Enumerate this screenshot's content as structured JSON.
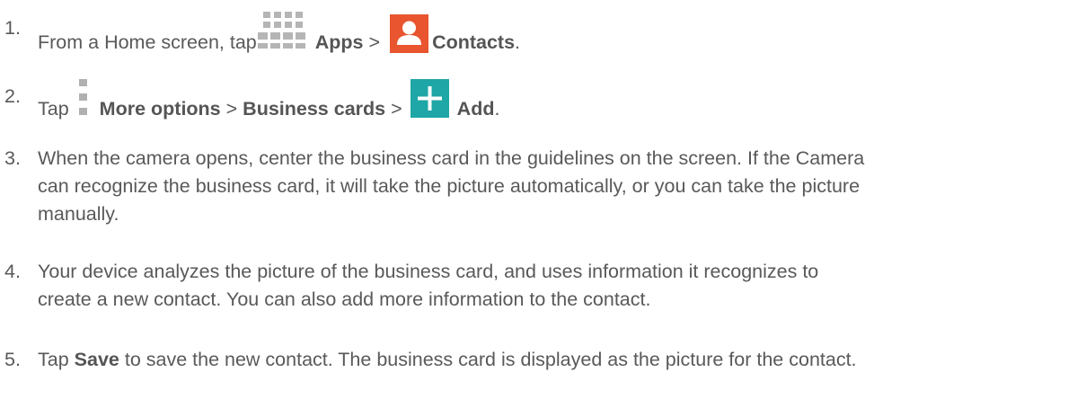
{
  "steps": [
    {
      "number": "1.",
      "pre": "From a Home screen, tap",
      "apps_label": "Apps",
      "separator": ">",
      "contacts_label": "Contacts",
      "end": "."
    },
    {
      "number": "2.",
      "pre": "Tap",
      "more_label": "More options",
      "separator1": ">",
      "business_label": "Business cards",
      "separator2": ">",
      "add_label": "Add",
      "end": "."
    },
    {
      "number": "3.",
      "lines": [
        "When the camera opens, center the business card in the guidelines on the screen. If the Camera",
        "can recognize the business card, it will take the picture automatically, or you can take the picture",
        "manually."
      ]
    },
    {
      "number": "4.",
      "lines": [
        "Your device analyzes the picture of the business card, and uses information it recognizes to",
        "create a new contact. You can also add more information to the contact."
      ]
    },
    {
      "number": "5.",
      "pre": "Tap",
      "save_label": "Save",
      "post": "to save the new contact. The business card is displayed as the picture for the contact."
    }
  ],
  "icons": {
    "apps": "apps-grid-icon",
    "contacts": "contacts-person-icon",
    "more": "more-options-icon",
    "add": "add-plus-icon"
  },
  "colors": {
    "text": "#595959",
    "contacts_bg": "#e8552f",
    "add_bg": "#1fa6a6",
    "apps_grid": "#b5b5b5"
  }
}
